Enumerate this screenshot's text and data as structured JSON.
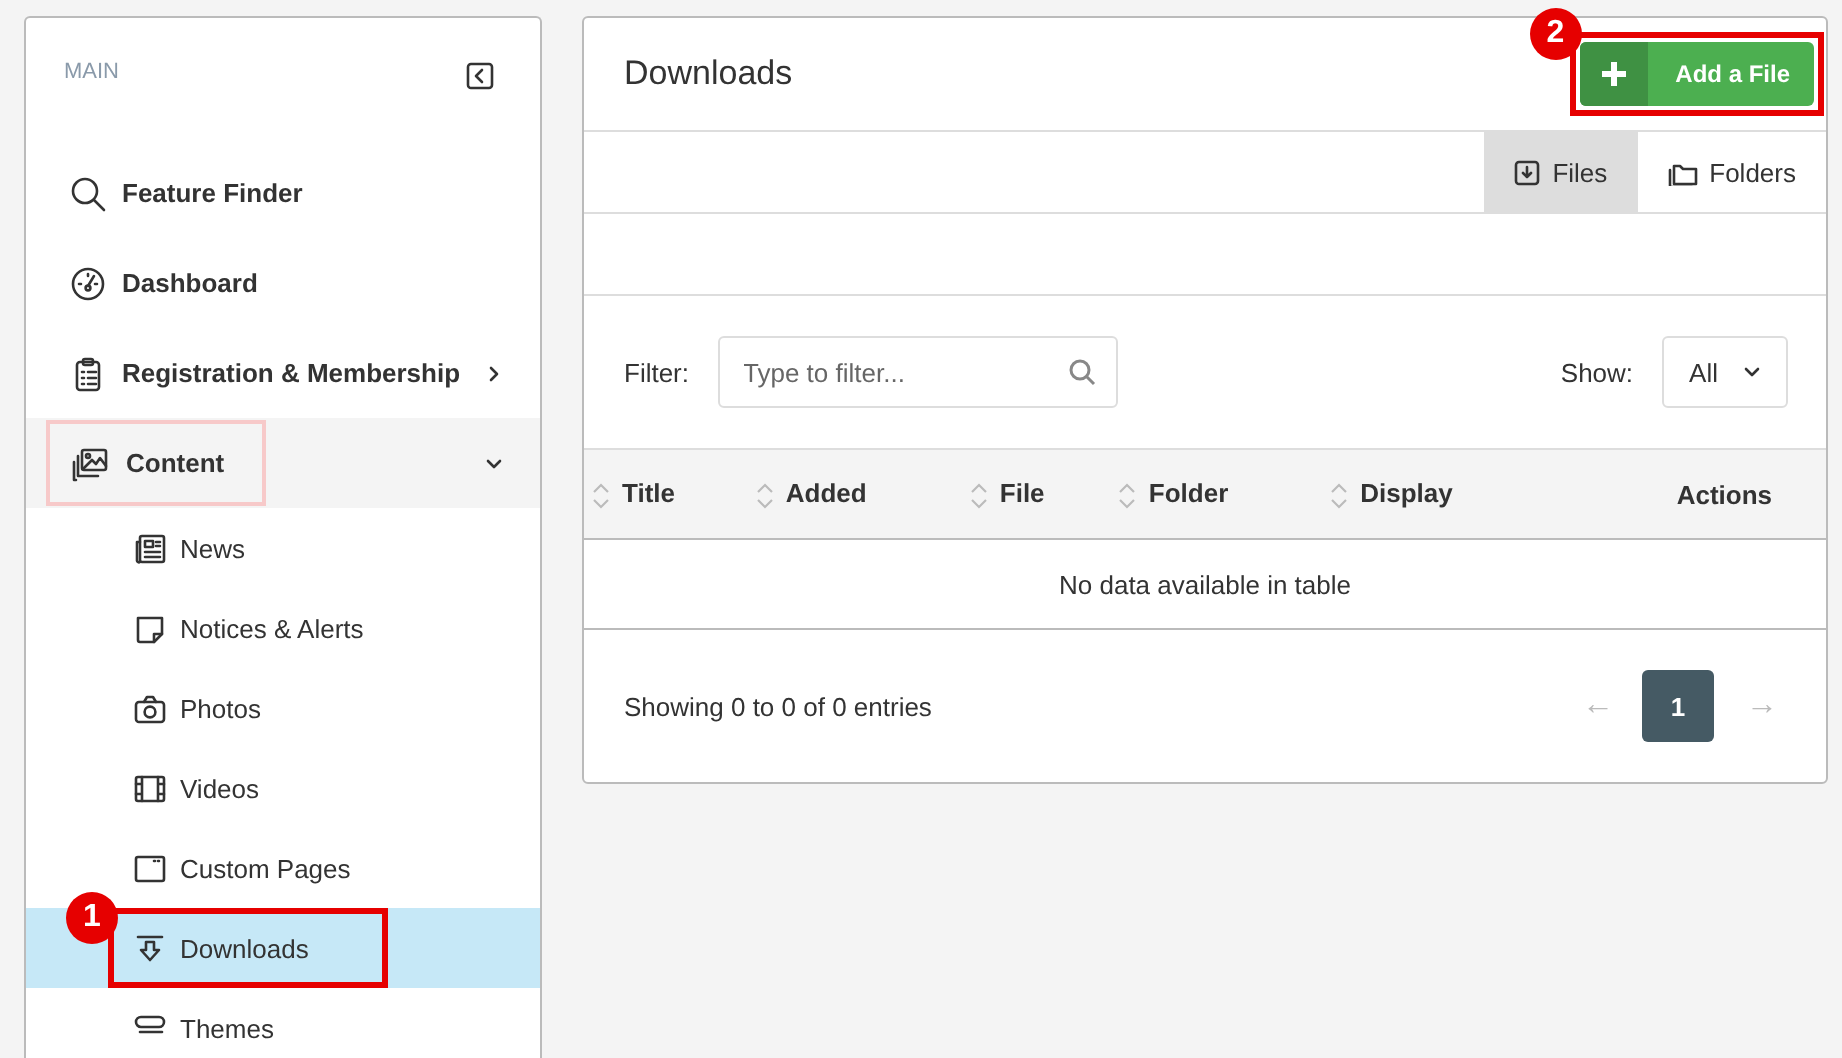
{
  "sidebar": {
    "heading": "MAIN",
    "items": [
      {
        "label": "Feature Finder",
        "has_children": false,
        "focused": false
      },
      {
        "label": "Dashboard",
        "has_children": false,
        "focused": false
      },
      {
        "label": "Registration & Membership",
        "has_children": true,
        "expanded": false,
        "focused": false
      },
      {
        "label": "Content",
        "has_children": true,
        "expanded": true,
        "focused": true,
        "children": [
          {
            "label": "News",
            "selected": false
          },
          {
            "label": "Notices & Alerts",
            "selected": false
          },
          {
            "label": "Photos",
            "selected": false
          },
          {
            "label": "Videos",
            "selected": false
          },
          {
            "label": "Custom Pages",
            "selected": false
          },
          {
            "label": "Downloads",
            "selected": true,
            "callout": "1"
          },
          {
            "label": "Themes",
            "selected": false
          }
        ]
      }
    ]
  },
  "main": {
    "title": "Downloads",
    "add_button": {
      "label": "Add a File",
      "callout": "2"
    },
    "view_tabs": [
      {
        "label": "Files",
        "selected": true
      },
      {
        "label": "Folders",
        "selected": false
      }
    ],
    "filter": {
      "label": "Filter:",
      "placeholder": "Type to filter..."
    },
    "show": {
      "label": "Show:",
      "value": "All"
    },
    "table": {
      "columns": [
        {
          "label": "Title",
          "sortable": true
        },
        {
          "label": "Added",
          "sortable": true
        },
        {
          "label": "File",
          "sortable": true
        },
        {
          "label": "Folder",
          "sortable": true
        },
        {
          "label": "Display",
          "sortable": true
        },
        {
          "label": "Actions",
          "sortable": false
        }
      ],
      "empty_message": "No data available in table"
    },
    "footer": {
      "info": "Showing 0 to 0 of 0 entries",
      "prev": {
        "label": "←",
        "disabled": true
      },
      "pages": [
        {
          "label": "1",
          "selected": true
        }
      ],
      "next": {
        "label": "→",
        "disabled": true
      }
    }
  }
}
